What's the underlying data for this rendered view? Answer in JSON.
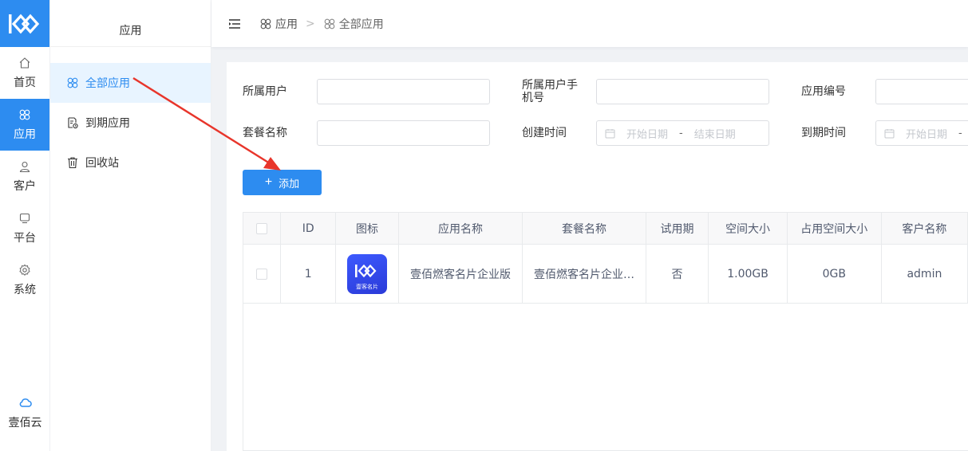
{
  "rail": {
    "items": [
      {
        "label": "首页",
        "icon": "home-icon"
      },
      {
        "label": "应用",
        "icon": "apps-icon",
        "active": true
      },
      {
        "label": "客户",
        "icon": "user-icon"
      },
      {
        "label": "平台",
        "icon": "monitor-icon"
      },
      {
        "label": "系统",
        "icon": "gear-icon"
      }
    ],
    "bottom_label": "壹佰云"
  },
  "subnav": {
    "title": "应用",
    "items": [
      {
        "label": "全部应用",
        "active": true
      },
      {
        "label": "到期应用"
      },
      {
        "label": "回收站"
      }
    ]
  },
  "breadcrumb": {
    "items": [
      "应用",
      "全部应用"
    ],
    "separator": ">"
  },
  "filters": {
    "owner_user_label": "所属用户",
    "owner_phone_label_line1": "所属用户手",
    "owner_phone_label_line2": "机号",
    "app_no_label": "应用编号",
    "package_name_label": "套餐名称",
    "created_time_label": "创建时间",
    "expire_time_label": "到期时间",
    "start_date_placeholder": "开始日期",
    "end_date_placeholder": "结束日期",
    "range_sep": "-"
  },
  "actions": {
    "add_label": "添加",
    "add_plus": "+"
  },
  "table": {
    "columns": [
      "ID",
      "图标",
      "应用名称",
      "套餐名称",
      "试用期",
      "空间大小",
      "占用空间大小",
      "客户名称"
    ],
    "rows": [
      {
        "id": "1",
        "icon_caption": "壹客名片",
        "app_name": "壹佰燃客名片企业版",
        "package_name": "壹佰燃客名片企业…",
        "trial": "否",
        "space": "1.00GB",
        "used_space": "0GB",
        "customer": "admin"
      }
    ]
  },
  "colors": {
    "primary": "#2d8cf0",
    "annotation_arrow": "#e8352b"
  }
}
